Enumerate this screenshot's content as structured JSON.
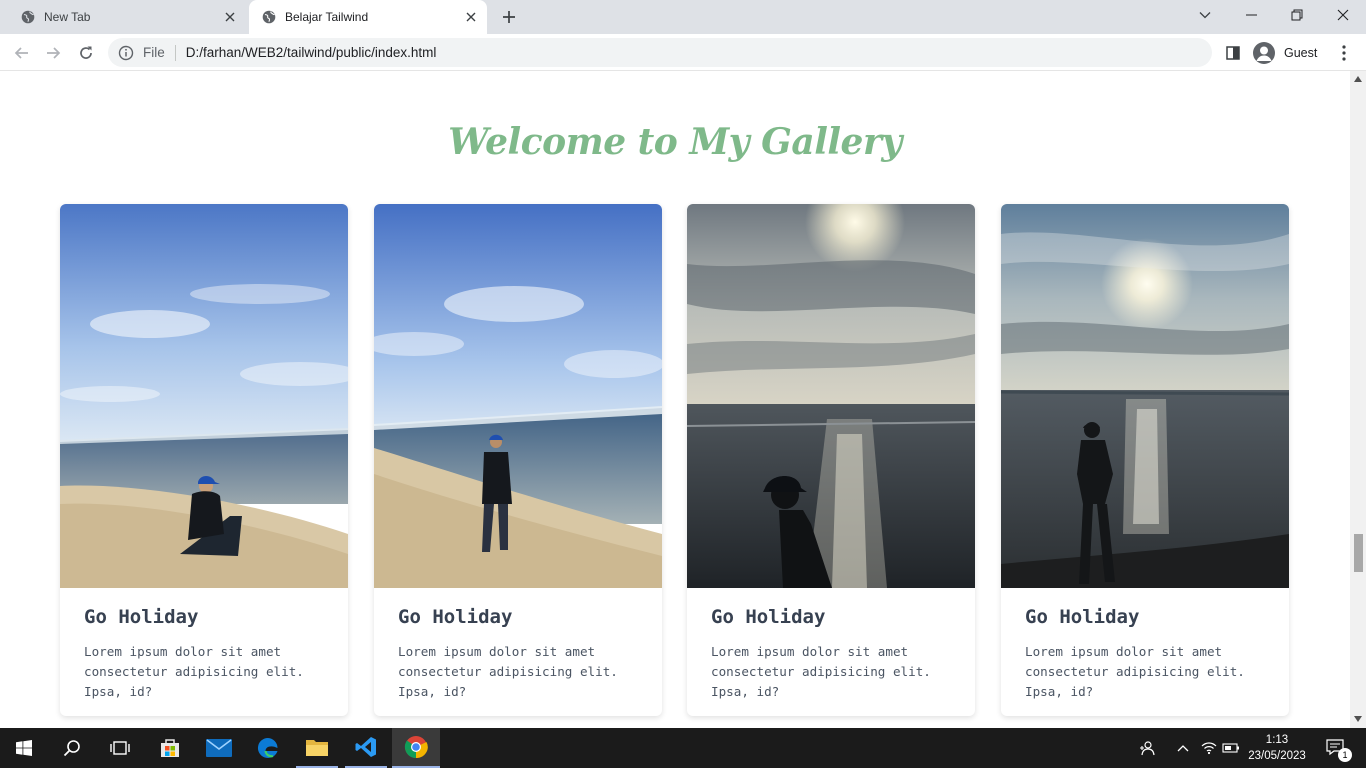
{
  "browser": {
    "tabs": [
      {
        "title": "New Tab"
      },
      {
        "title": "Belajar Tailwind"
      }
    ],
    "address": {
      "scheme_label": "File",
      "url": "D:/farhan/WEB2/tailwind/public/index.html"
    },
    "profile_label": "Guest"
  },
  "page": {
    "title": "Welcome to My Gallery",
    "title_color": "#7fb98a",
    "cards": [
      {
        "title": "Go Holiday",
        "text": "Lorem ipsum dolor sit amet consectetur adipisicing elit. Ipsa, id?"
      },
      {
        "title": "Go Holiday",
        "text": "Lorem ipsum dolor sit amet consectetur adipisicing elit. Ipsa, id?"
      },
      {
        "title": "Go Holiday",
        "text": "Lorem ipsum dolor sit amet consectetur adipisicing elit. Ipsa, id?"
      },
      {
        "title": "Go Holiday",
        "text": "Lorem ipsum dolor sit amet consectetur adipisicing elit. Ipsa, id?"
      }
    ]
  },
  "taskbar": {
    "time": "1:13",
    "date": "23/05/2023",
    "notification_count": "1",
    "apps": [
      "start-icon",
      "search-icon",
      "task-view-icon",
      "store-icon",
      "mail-icon",
      "edge-icon",
      "file-explorer-icon",
      "vscode-icon",
      "chrome-icon"
    ]
  }
}
